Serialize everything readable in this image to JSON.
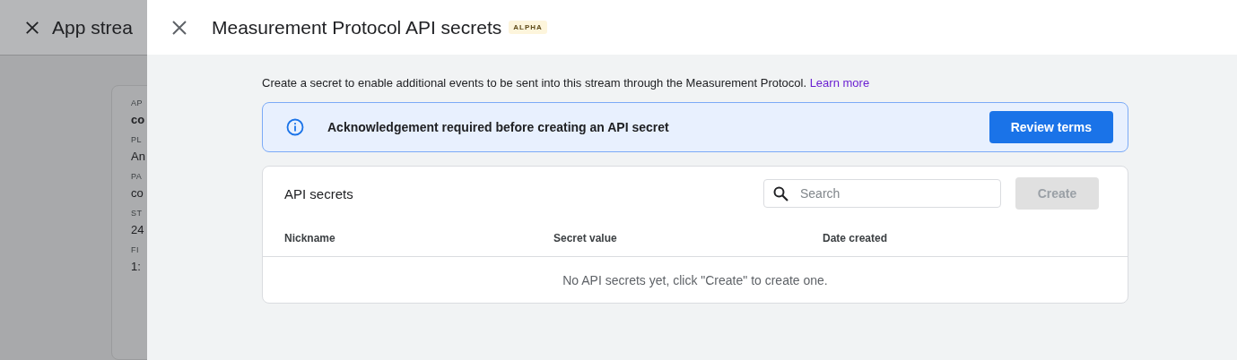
{
  "background_page": {
    "title": "App strea",
    "card_fields": [
      {
        "label": "AP",
        "value": "co",
        "bold": true
      },
      {
        "label": "PL",
        "value": "An",
        "bold": false
      },
      {
        "label": "PA",
        "value": "co",
        "bold": false
      },
      {
        "label": "ST",
        "value": "24",
        "bold": false
      },
      {
        "label": "FI",
        "value": "1:",
        "bold": false
      }
    ]
  },
  "drawer": {
    "title": "Measurement Protocol API secrets",
    "badge": "ALPHA",
    "intro": "Create a secret to enable additional events to be sent into this stream through the Measurement Protocol.",
    "intro_link": "Learn more",
    "banner": {
      "message": "Acknowledgement required before creating an API secret",
      "button": "Review terms"
    },
    "secrets_card": {
      "title": "API secrets",
      "search": {
        "placeholder": "Search"
      },
      "create_button": {
        "label": "Create",
        "disabled": true
      },
      "table": {
        "columns": [
          "Nickname",
          "Secret value",
          "Date created"
        ],
        "empty_message": "No API secrets yet, click \"Create\" to create one."
      }
    }
  }
}
